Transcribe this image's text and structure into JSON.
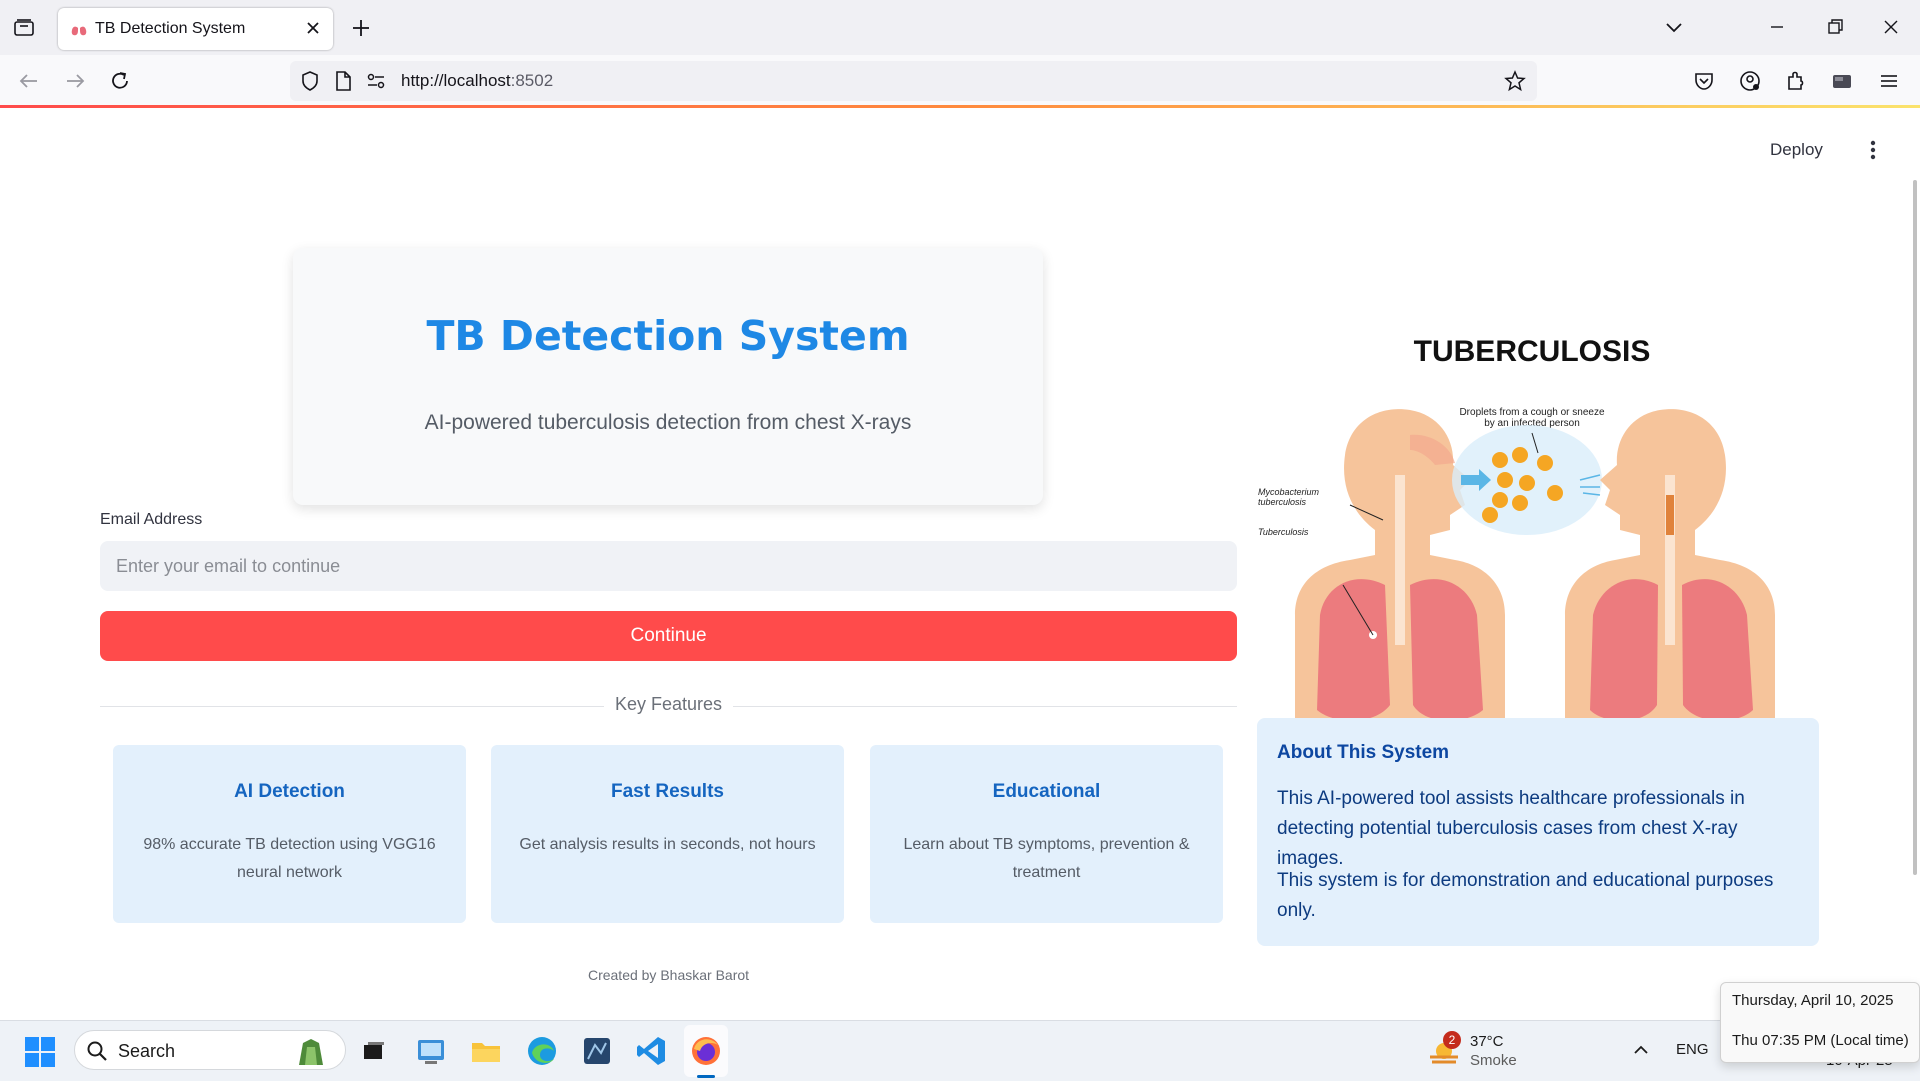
{
  "browser": {
    "tab_title": "TB Detection System",
    "url_host": "http://localhost",
    "url_port": ":8502"
  },
  "toolbar": {
    "deploy_label": "Deploy"
  },
  "hero": {
    "title": "TB Detection System",
    "subtitle": "AI-powered tuberculosis detection from chest X-rays"
  },
  "form": {
    "email_label": "Email Address",
    "email_placeholder": "Enter your email to continue",
    "continue_label": "Continue"
  },
  "features": {
    "heading": "Key Features",
    "items": [
      {
        "title": "AI Detection",
        "desc": "98% accurate TB detection using VGG16 neural network"
      },
      {
        "title": "Fast Results",
        "desc": "Get analysis results in seconds, not hours"
      },
      {
        "title": "Educational",
        "desc": "Learn about TB symptoms, prevention & treatment"
      }
    ]
  },
  "credit": "Created by Bhaskar Barot",
  "illustration": {
    "title": "TUBERCULOSIS",
    "label_droplets_1": "Droplets from a cough or sneeze",
    "label_droplets_2": "by an infected person",
    "label_myco_1": "Mycobacterium",
    "label_myco_2": "tuberculosis",
    "label_tb": "Tuberculosis"
  },
  "about": {
    "title": "About This System",
    "p1": "This AI-powered tool assists healthcare professionals in detecting potential tuberculosis cases from chest X-ray images.",
    "p2": "This system is for demonstration and educational purposes only."
  },
  "taskbar": {
    "search_label": "Search",
    "weather_badge": "2",
    "weather_temp": "37°C",
    "weather_condition": "Smoke",
    "language": "ENG",
    "date_partial": "10-Apr-25"
  },
  "clock_tooltip": {
    "line1": "Thursday, April 10, 2025",
    "line2": "Thu 07:35 PM (Local time)"
  },
  "colors": {
    "accent_blue": "#1e88e5",
    "button_red": "#ff4b4b",
    "feature_bg": "#e3f0fc"
  }
}
